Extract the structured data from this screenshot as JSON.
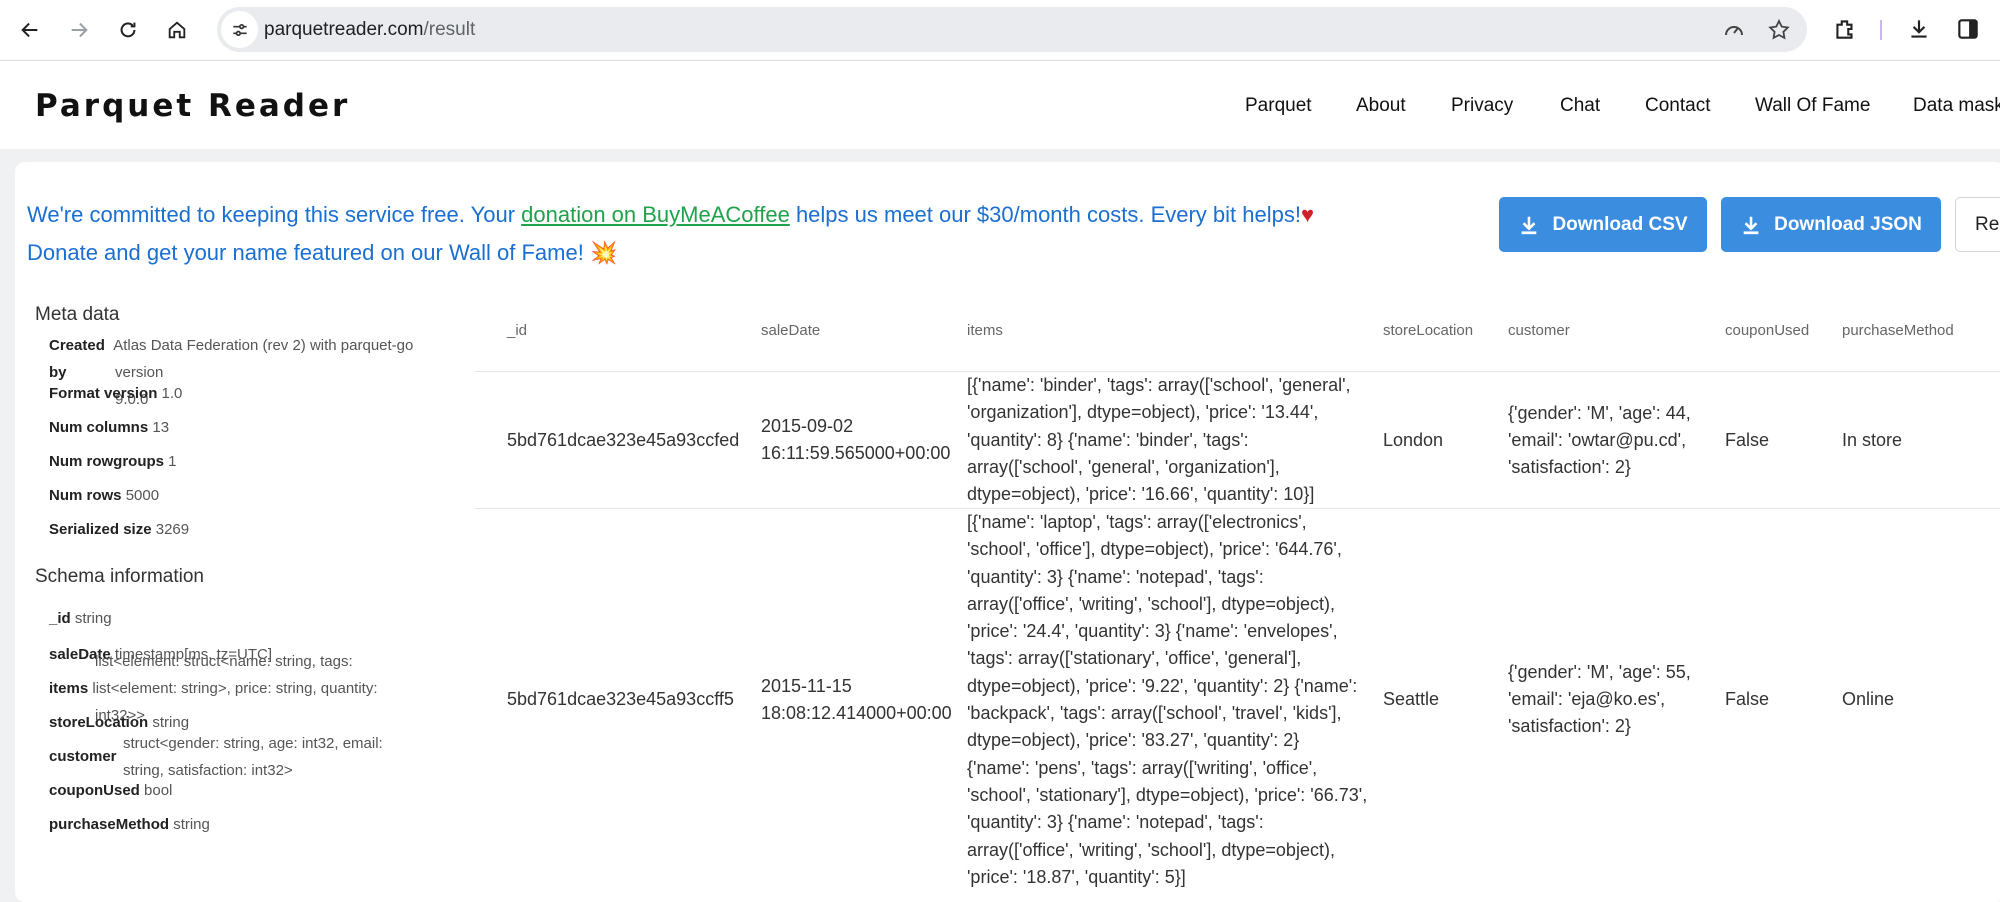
{
  "browser": {
    "url_host": "parquetreader.com",
    "url_path": "/result"
  },
  "site": {
    "logo": "Parquet Reader",
    "nav": [
      "Parquet",
      "About",
      "Privacy",
      "Chat",
      "Contact",
      "Wall Of Fame",
      "Data mask"
    ]
  },
  "notice": {
    "line1_pre": "We're committed to keeping this service free. Your ",
    "link": "donation on BuyMeACoffee",
    "line1_post": " helps us meet our $30/month costs. Every bit helps!",
    "heart": "♥",
    "line2": "Donate and get your name featured on our Wall of Fame! 💥"
  },
  "actions": {
    "download_csv": "Download CSV",
    "download_json": "Download JSON",
    "third": "Re"
  },
  "meta": {
    "title": "Meta data",
    "rows": [
      {
        "label": "Created",
        "value": "Atlas Data Federation (rev 2) with parquet-go"
      },
      {
        "label": "by",
        "value": "version 9.0.0"
      },
      {
        "label": "Format version",
        "value": "1.0"
      },
      {
        "label": "Num columns",
        "value": "13"
      },
      {
        "label": "Num rowgroups",
        "value": "1"
      },
      {
        "label": "Num rows",
        "value": "5000"
      },
      {
        "label": "Serialized size",
        "value": "3269"
      }
    ]
  },
  "schema": {
    "title": "Schema information",
    "rows": [
      {
        "label": "_id",
        "value": "string"
      },
      {
        "label": "saleDate",
        "value": "timestamp[ms, tz=UTC]"
      },
      {
        "label": "",
        "value": "list<element: struct<name: string, tags:"
      },
      {
        "label": "items",
        "value": "list<element: string>, price: string, quantity:"
      },
      {
        "label": "",
        "value": "int32>>"
      },
      {
        "label": "storeLocation",
        "value": "string"
      },
      {
        "label": "",
        "value": "struct<gender: string, age: int32, email:"
      },
      {
        "label": "customer",
        "value": ""
      },
      {
        "label": "",
        "value": "string, satisfaction: int32>"
      },
      {
        "label": "couponUsed",
        "value": "bool"
      },
      {
        "label": "purchaseMethod",
        "value": "string"
      }
    ]
  },
  "table": {
    "columns": [
      "_id",
      "saleDate",
      "items",
      "storeLocation",
      "customer",
      "couponUsed",
      "purchaseMethod"
    ],
    "rows": [
      {
        "id": "5bd761dcae323e45a93ccfed",
        "saleDate": [
          "2015-09-02",
          "16:11:59.565000+00:00"
        ],
        "items": [
          "[{'name': 'binder', 'tags': array(['school', 'general',",
          "'organization'], dtype=object), 'price': '13.44',",
          "'quantity': 8} {'name': 'binder', 'tags':",
          "array(['school', 'general', 'organization'],",
          "dtype=object), 'price': '16.66', 'quantity': 10}]"
        ],
        "storeLocation": "London",
        "customer": [
          "{'gender': 'M', 'age': 44,",
          "'email': 'owtar@pu.cd',",
          "'satisfaction': 2}"
        ],
        "couponUsed": "False",
        "purchaseMethod": "In store"
      },
      {
        "id": "5bd761dcae323e45a93ccff5",
        "saleDate": [
          "2015-11-15",
          "18:08:12.414000+00:00"
        ],
        "items": [
          "[{'name': 'laptop', 'tags': array(['electronics',",
          "'school', 'office'], dtype=object), 'price': '644.76',",
          "'quantity': 3} {'name': 'notepad', 'tags':",
          "array(['office', 'writing', 'school'], dtype=object),",
          "'price': '24.4', 'quantity': 3} {'name': 'envelopes',",
          "'tags': array(['stationary', 'office', 'general'],",
          "dtype=object), 'price': '9.22', 'quantity': 2} {'name':",
          "'backpack', 'tags': array(['school', 'travel', 'kids'],",
          "dtype=object), 'price': '83.27', 'quantity': 2}",
          "{'name': 'pens', 'tags': array(['writing', 'office',",
          "'school', 'stationary'], dtype=object), 'price': '66.73',",
          "'quantity': 3} {'name': 'notepad', 'tags':",
          "array(['office', 'writing', 'school'], dtype=object),",
          "'price': '18.87', 'quantity': 5}]"
        ],
        "storeLocation": "Seattle",
        "customer": [
          "{'gender': 'M', 'age': 55,",
          "'email': 'eja@ko.es',",
          "'satisfaction': 2}"
        ],
        "couponUsed": "False",
        "purchaseMethod": "Online"
      }
    ]
  },
  "icons": [
    "back-icon",
    "forward-icon",
    "reload-icon",
    "home-icon",
    "site-settings-icon",
    "performance-icon",
    "bookmark-star-icon",
    "extensions-icon",
    "download-icon",
    "side-panel-icon"
  ]
}
